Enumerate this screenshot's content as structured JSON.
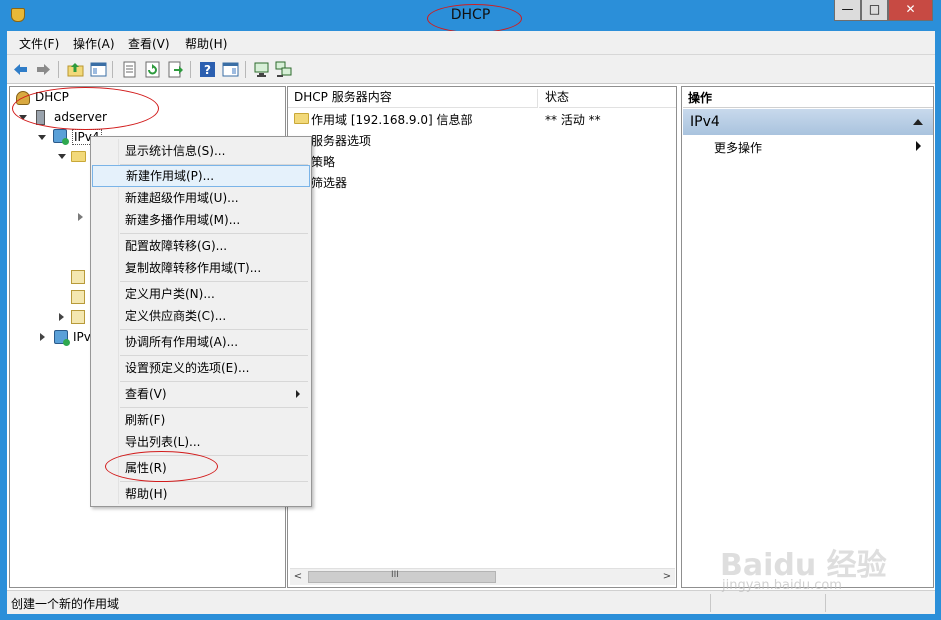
{
  "window": {
    "title": "DHCP",
    "min_glyph": "—",
    "max_glyph": "□",
    "close_glyph": "✕"
  },
  "menu": [
    "文件(F)",
    "操作(A)",
    "查看(V)",
    "帮助(H)"
  ],
  "toolbar_icons": [
    "back-arrow-icon",
    "forward-arrow-icon",
    "up-folder-icon",
    "show-hide-tree-icon",
    "properties-sheet-icon",
    "refresh-icon",
    "export-list-icon",
    "help-icon",
    "show-action-pane-icon",
    "server-monitor-icon",
    "server-network-icon"
  ],
  "tree": {
    "root": "DHCP",
    "server": "adserver",
    "ipv4": "IPv4",
    "ipv6": "IPv"
  },
  "content": {
    "columns": [
      "DHCP 服务器内容",
      "状态"
    ],
    "rows": [
      {
        "name": "作用域 [192.168.9.0] 信息部",
        "status": "** 活动 **"
      },
      {
        "name": "服务器选项",
        "status": ""
      },
      {
        "name": "策略",
        "status": ""
      },
      {
        "name": "筛选器",
        "status": ""
      }
    ],
    "scroll_glyph": "III"
  },
  "actions": {
    "header": "操作",
    "section": "IPv4",
    "more": "更多操作"
  },
  "context_menu": {
    "items": [
      "显示统计信息(S)...",
      "新建作用域(P)...",
      "新建超级作用域(U)...",
      "新建多播作用域(M)...",
      "配置故障转移(G)...",
      "复制故障转移作用域(T)...",
      "定义用户类(N)...",
      "定义供应商类(C)...",
      "协调所有作用域(A)...",
      "设置预定义的选项(E)...",
      "查看(V)",
      "刷新(F)",
      "导出列表(L)...",
      "属性(R)",
      "帮助(H)"
    ],
    "highlighted_index": 1
  },
  "status_bar": {
    "text": "创建一个新的作用域"
  },
  "watermark": {
    "main": "Baidu 经验",
    "sub": "jingyan.baidu.com"
  },
  "colors": {
    "title_bar": "#2b8fd9",
    "close_button": "#c74a43",
    "highlight": "#e5f1fb",
    "annotation_red": "#d21c1c"
  }
}
